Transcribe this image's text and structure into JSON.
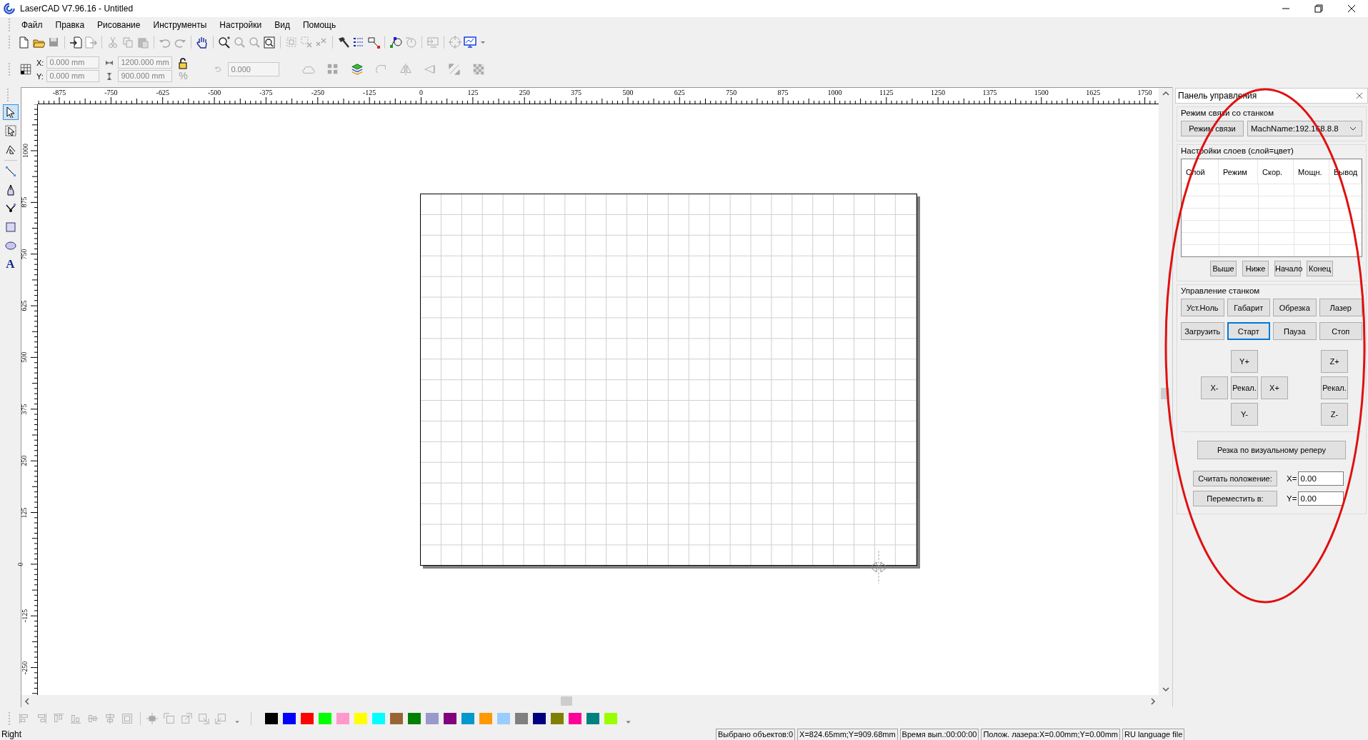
{
  "window": {
    "title": "LaserCAD V7.96.16 - Untitled"
  },
  "menu": [
    "Файл",
    "Правка",
    "Рисование",
    "Инструменты",
    "Настройки",
    "Вид",
    "Помощь"
  ],
  "position_toolbar": {
    "x_label": "X:",
    "x_value": "0.000 mm",
    "y_label": "Y:",
    "y_value": "0.000 mm",
    "width_value": "1200.000 mm",
    "height_value": "900.000 mm",
    "scale_label": "%",
    "rotation_value": "0.000"
  },
  "tools": [
    {
      "kind": "select",
      "selected": true
    },
    {
      "kind": "node_select",
      "selected": false
    },
    {
      "kind": "polyline",
      "selected": false
    },
    {
      "kind": "line",
      "selected": false
    },
    {
      "kind": "pen",
      "selected": false
    },
    {
      "kind": "node_edit",
      "selected": false
    },
    {
      "kind": "rectangle",
      "selected": false
    },
    {
      "kind": "ellipse",
      "selected": false
    },
    {
      "kind": "text",
      "label": "A",
      "selected": false
    }
  ],
  "ruler": {
    "horizontal": [
      "-875",
      "-750",
      "-625",
      "-500",
      "-375",
      "-250",
      "-125",
      "0",
      "125",
      "250",
      "375",
      "500",
      "625",
      "750",
      "875",
      "1000",
      "1125",
      "1250",
      "1375",
      "1500",
      "1625",
      "1750"
    ],
    "vertical": [
      "1000",
      "875",
      "750",
      "625",
      "500",
      "375",
      "250",
      "125",
      "0",
      "-125",
      "-250"
    ]
  },
  "control_panel": {
    "title": "Панель управления",
    "connection": {
      "title": "Режим связи со станком",
      "button": "Режим связи",
      "device": "MachName:192.168.8.8"
    },
    "layers": {
      "title": "Настройки слоев (слой=цвет)",
      "columns": [
        "Слой",
        "Режим",
        "Скор.",
        "Мощн.",
        "Вывод"
      ],
      "buttons": [
        "Выше",
        "Ниже",
        "Начало",
        "Конец"
      ]
    },
    "machine": {
      "title": "Управление станком",
      "buttons": [
        {
          "label": "Уст.Ноль",
          "focused": false
        },
        {
          "label": "Габарит",
          "focused": false
        },
        {
          "label": "Обрезка",
          "focused": false
        },
        {
          "label": "Лазер",
          "focused": false
        },
        {
          "label": "Загрузить",
          "focused": false
        },
        {
          "label": "Старт",
          "focused": true
        },
        {
          "label": "Пауза",
          "focused": false
        },
        {
          "label": "Стоп",
          "focused": false
        }
      ],
      "jog_xy": [
        "Y+",
        "X-",
        "Рекал.",
        "X+",
        "Y-"
      ],
      "jog_z": [
        "Z+",
        "Рекал.",
        "Z-"
      ]
    },
    "visual_cut_button": "Резка по визуальному реперу",
    "position": {
      "read_button": "Считать положение:",
      "move_button": "Переместить в:",
      "x_label": "X=",
      "x_value": "0.00",
      "y_label": "Y=",
      "y_value": "0.00"
    }
  },
  "palette": [
    {
      "color": "#000000"
    },
    {
      "color": "#0000ff"
    },
    {
      "color": "#ff0000"
    },
    {
      "color": "#00ff00"
    },
    {
      "color": "#ff99cc"
    },
    {
      "color": "#ffff00"
    },
    {
      "color": "#00ffff"
    },
    {
      "color": "#996633"
    },
    {
      "color": "#008000"
    },
    {
      "color": "#9999cc"
    },
    {
      "color": "#800080"
    },
    {
      "color": "#0099cc"
    },
    {
      "color": "#ff9900"
    },
    {
      "color": "#99ccff"
    },
    {
      "color": "#808080"
    },
    {
      "color": "#000080"
    },
    {
      "color": "#808000"
    },
    {
      "color": "#ff0099"
    },
    {
      "color": "#008080"
    },
    {
      "color": "#99ff00"
    }
  ],
  "status_bar": {
    "hint": "Right",
    "fields": [
      "Выбрано объектов:0",
      "X=824.65mm;Y=909.68mm",
      "Время вып.:00:00:00",
      "Полож. лазера:X=0.00mm;Y=0.00mm",
      "RU language file"
    ]
  }
}
